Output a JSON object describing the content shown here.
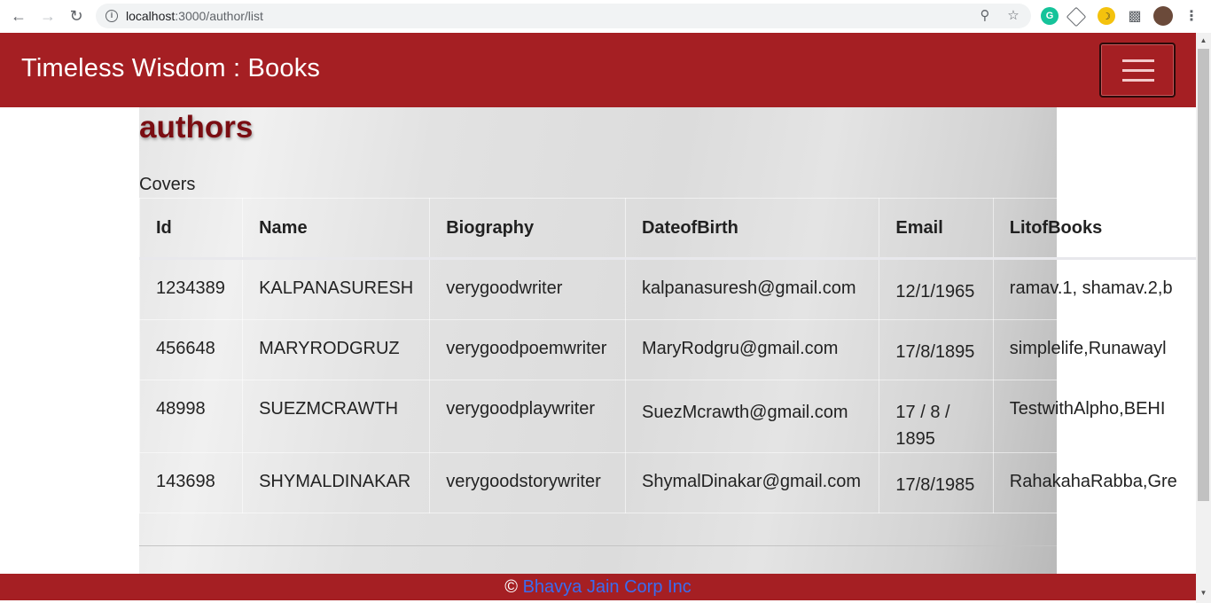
{
  "browser": {
    "url_host": "localhost",
    "url_path": ":3000/author/list"
  },
  "app": {
    "brand": "Timeless Wisdom : Books"
  },
  "page": {
    "heading": "authors",
    "caption": "Covers"
  },
  "table": {
    "headers": [
      "Id",
      "Name",
      "Biography",
      "DateofBirth",
      "Email",
      "LitofBooks"
    ],
    "rows": [
      [
        "1234389",
        "KALPANASURESH",
        "verygoodwriter",
        "kalpanasuresh@gmail.com",
        "12/1/1965",
        "ramav.1, shamav.2,b"
      ],
      [
        "456648",
        "MARYRODGRUZ",
        "verygoodpoemwriter",
        "MaryRodgru@gmail.com",
        "17/8/1895",
        "simplelife,Runawayl"
      ],
      [
        "48998",
        "SUEZMCRAWTH",
        "verygoodplaywriter",
        "SuezMcrawth@gmail.com",
        "17 / 8 / 1895",
        "TestwithAlpho,BEHI"
      ],
      [
        "143698",
        "SHYMALDINAKAR",
        "verygoodstorywriter",
        "ShymalDinakar@gmail.com",
        "17/8/1985",
        "RahakahaRabba,Gre"
      ]
    ]
  },
  "footer": {
    "copyright": "©",
    "company": "Bhavya Jain Corp Inc"
  },
  "colors": {
    "brand_red": "#a51f23",
    "heading": "#7a0d12",
    "link": "#3a6cf0"
  }
}
